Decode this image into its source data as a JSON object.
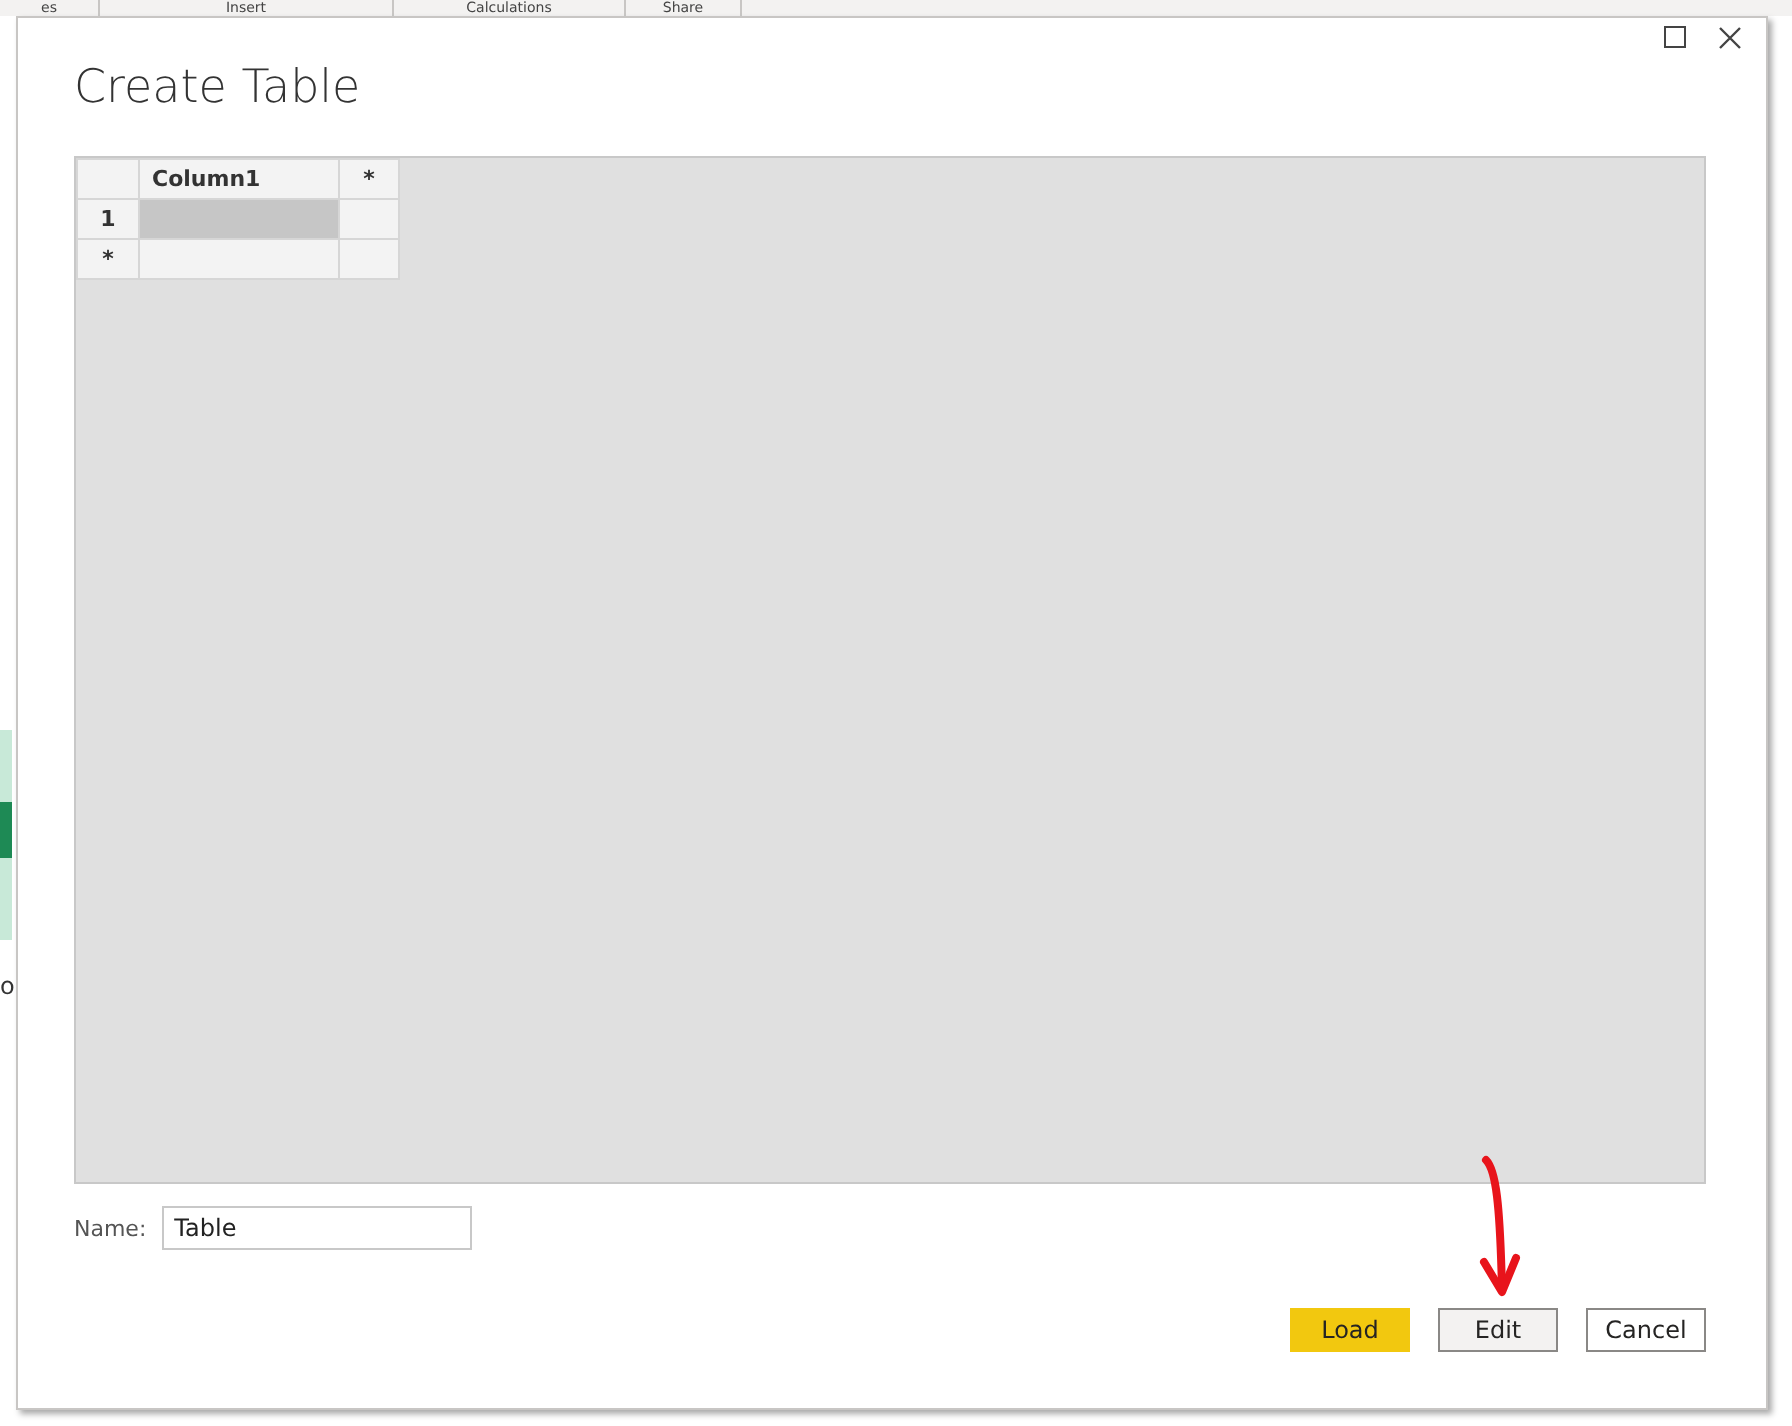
{
  "ribbon_groups": [
    "es",
    "Insert",
    "Calculations",
    "Share"
  ],
  "background_app": {
    "text": "o"
  },
  "dialog": {
    "title": "Create Table",
    "grid": {
      "columns": [
        "Column1",
        "*"
      ],
      "rows": [
        {
          "header": "1",
          "selected": true
        },
        {
          "header": "*",
          "selected": false
        }
      ]
    },
    "name_field": {
      "label": "Name:",
      "value": "Table"
    },
    "buttons": [
      {
        "label": "Load",
        "kind": "primary"
      },
      {
        "label": "Edit",
        "kind": "secondary"
      },
      {
        "label": "Cancel",
        "kind": "default"
      }
    ]
  }
}
